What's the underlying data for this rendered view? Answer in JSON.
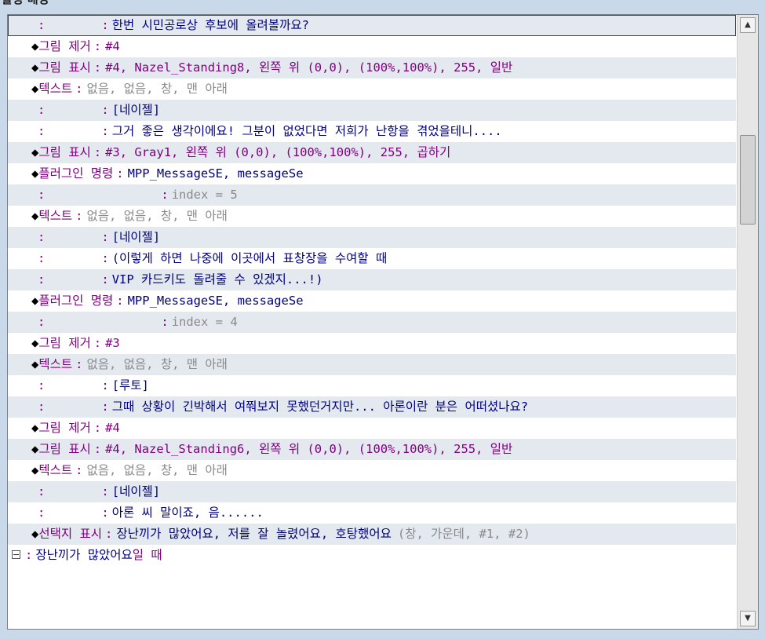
{
  "window": {
    "title": "활성 배경"
  },
  "rows": [
    {
      "kind": "cont",
      "text": "한번 시민공로상 후보에 올려볼까요?",
      "tclass": "navy"
    },
    {
      "kind": "cmd",
      "cmd": "그림 제거",
      "args": "#4",
      "aclass": "purple"
    },
    {
      "kind": "cmd",
      "cmd": "그림 표시",
      "args": "#4, Nazel_Standing8, 왼쪽 위 (0,0), (100%,100%), 255, 일반",
      "aclass": "purple"
    },
    {
      "kind": "cmd",
      "cmd": "텍스트",
      "args": "없음, 없음, 창, 맨 아래",
      "aclass": "gray"
    },
    {
      "kind": "cont",
      "text": "[네이젤]",
      "tclass": "navy"
    },
    {
      "kind": "cont",
      "text": "그거 좋은 생각이에요! 그분이 없었다면 저희가 난항을 겪었을테니....",
      "tclass": "navy"
    },
    {
      "kind": "cmd",
      "cmd": "그림 표시",
      "args": "#3, Gray1, 왼쪽 위 (0,0), (100%,100%), 255, 곱하기",
      "aclass": "purple"
    },
    {
      "kind": "cmd",
      "cmd": "플러그인 명령",
      "args": "MPP_MessageSE, messageSe",
      "aclass": "navy"
    },
    {
      "kind": "cont2",
      "text": "index = 5",
      "tclass": "gray"
    },
    {
      "kind": "cmd",
      "cmd": "텍스트",
      "args": "없음, 없음, 창, 맨 아래",
      "aclass": "gray"
    },
    {
      "kind": "cont",
      "text": "[네이젤]",
      "tclass": "navy"
    },
    {
      "kind": "cont",
      "text": "(이렇게 하면 나중에 이곳에서 표창장을 수여할 때",
      "tclass": "navy"
    },
    {
      "kind": "cont",
      "text": "VIP 카드키도 돌려줄 수 있겠지...!)",
      "tclass": "navy"
    },
    {
      "kind": "cmd",
      "cmd": "플러그인 명령",
      "args": "MPP_MessageSE, messageSe",
      "aclass": "navy"
    },
    {
      "kind": "cont2",
      "text": "index = 4",
      "tclass": "gray"
    },
    {
      "kind": "cmd",
      "cmd": "그림 제거",
      "args": "#3",
      "aclass": "purple"
    },
    {
      "kind": "cmd",
      "cmd": "텍스트",
      "args": "없음, 없음, 창, 맨 아래",
      "aclass": "gray"
    },
    {
      "kind": "cont",
      "text": "[루토]",
      "tclass": "navy"
    },
    {
      "kind": "cont",
      "text": "그때 상황이 긴박해서 여쭤보지 못했던거지만... 아론이란 분은 어떠셨나요?",
      "tclass": "navy"
    },
    {
      "kind": "cmd",
      "cmd": "그림 제거",
      "args": "#4",
      "aclass": "purple"
    },
    {
      "kind": "cmd",
      "cmd": "그림 표시",
      "args": "#4, Nazel_Standing6, 왼쪽 위 (0,0), (100%,100%), 255, 일반",
      "aclass": "purple"
    },
    {
      "kind": "cmd",
      "cmd": "텍스트",
      "args": "없음, 없음, 창, 맨 아래",
      "aclass": "gray"
    },
    {
      "kind": "cont",
      "text": "[네이젤]",
      "tclass": "navy"
    },
    {
      "kind": "cont",
      "text": "아론 씨 말이죠, 음......",
      "tclass": "navy"
    },
    {
      "kind": "choice",
      "cmd": "선택지 표시",
      "args": "장난끼가 많았어요, 저를 잘 놀렸어요, 호탕했어요",
      "extra": "(창, 가운데, #1, #2)"
    },
    {
      "kind": "branch",
      "label": "장난끼가 많았어요",
      "suffix": "일 때"
    }
  ],
  "glyphs": {
    "diamond": "◆",
    "colon": ":",
    "scroll_up": "▲",
    "scroll_down": "▼"
  }
}
